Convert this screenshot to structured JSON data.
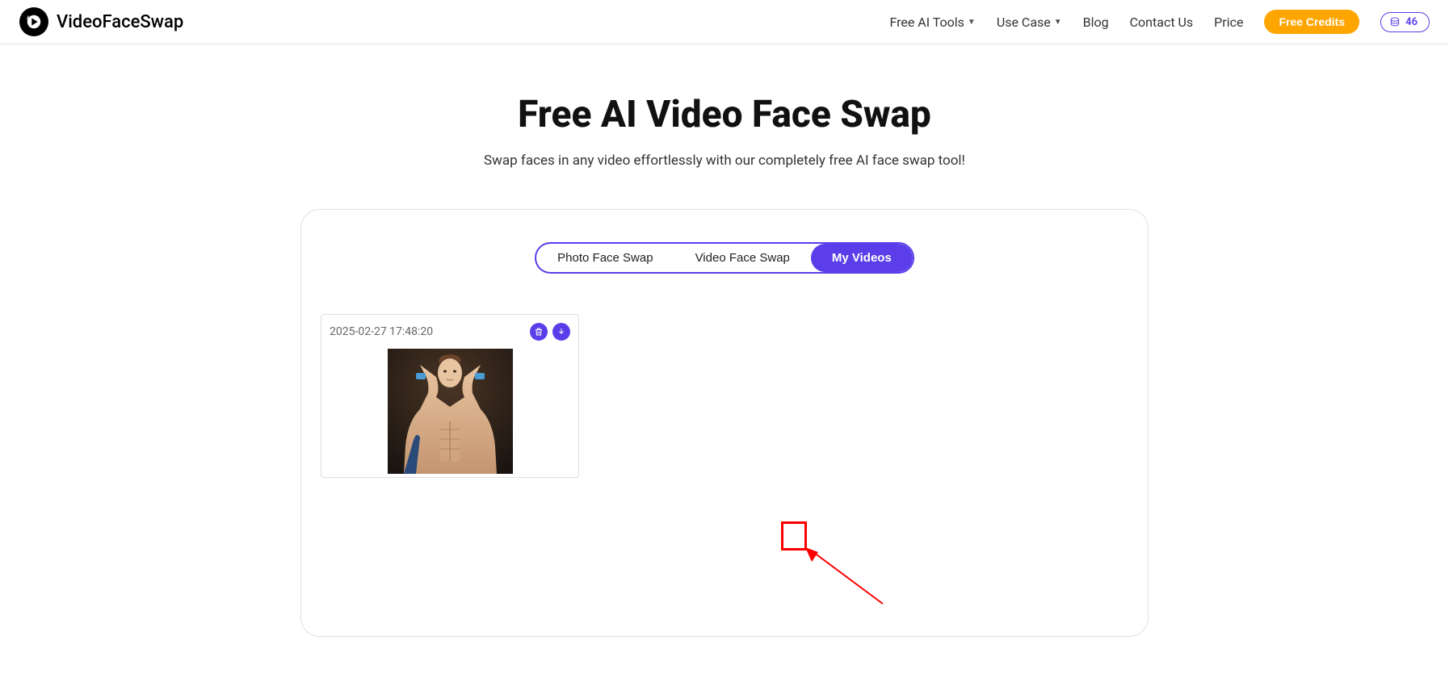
{
  "header": {
    "brand": "VideoFaceSwap",
    "nav": {
      "free_ai_tools": "Free AI Tools",
      "use_case": "Use Case",
      "blog": "Blog",
      "contact_us": "Contact Us",
      "price": "Price",
      "free_credits": "Free Credits"
    },
    "coins": "46"
  },
  "hero": {
    "title": "Free AI Video Face Swap",
    "subtitle": "Swap faces in any video effortlessly with our completely free AI face swap tool!"
  },
  "tabs": {
    "photo": "Photo Face Swap",
    "video": "Video Face Swap",
    "my_videos": "My Videos"
  },
  "videos": [
    {
      "timestamp": "2025-02-27 17:48:20"
    }
  ]
}
